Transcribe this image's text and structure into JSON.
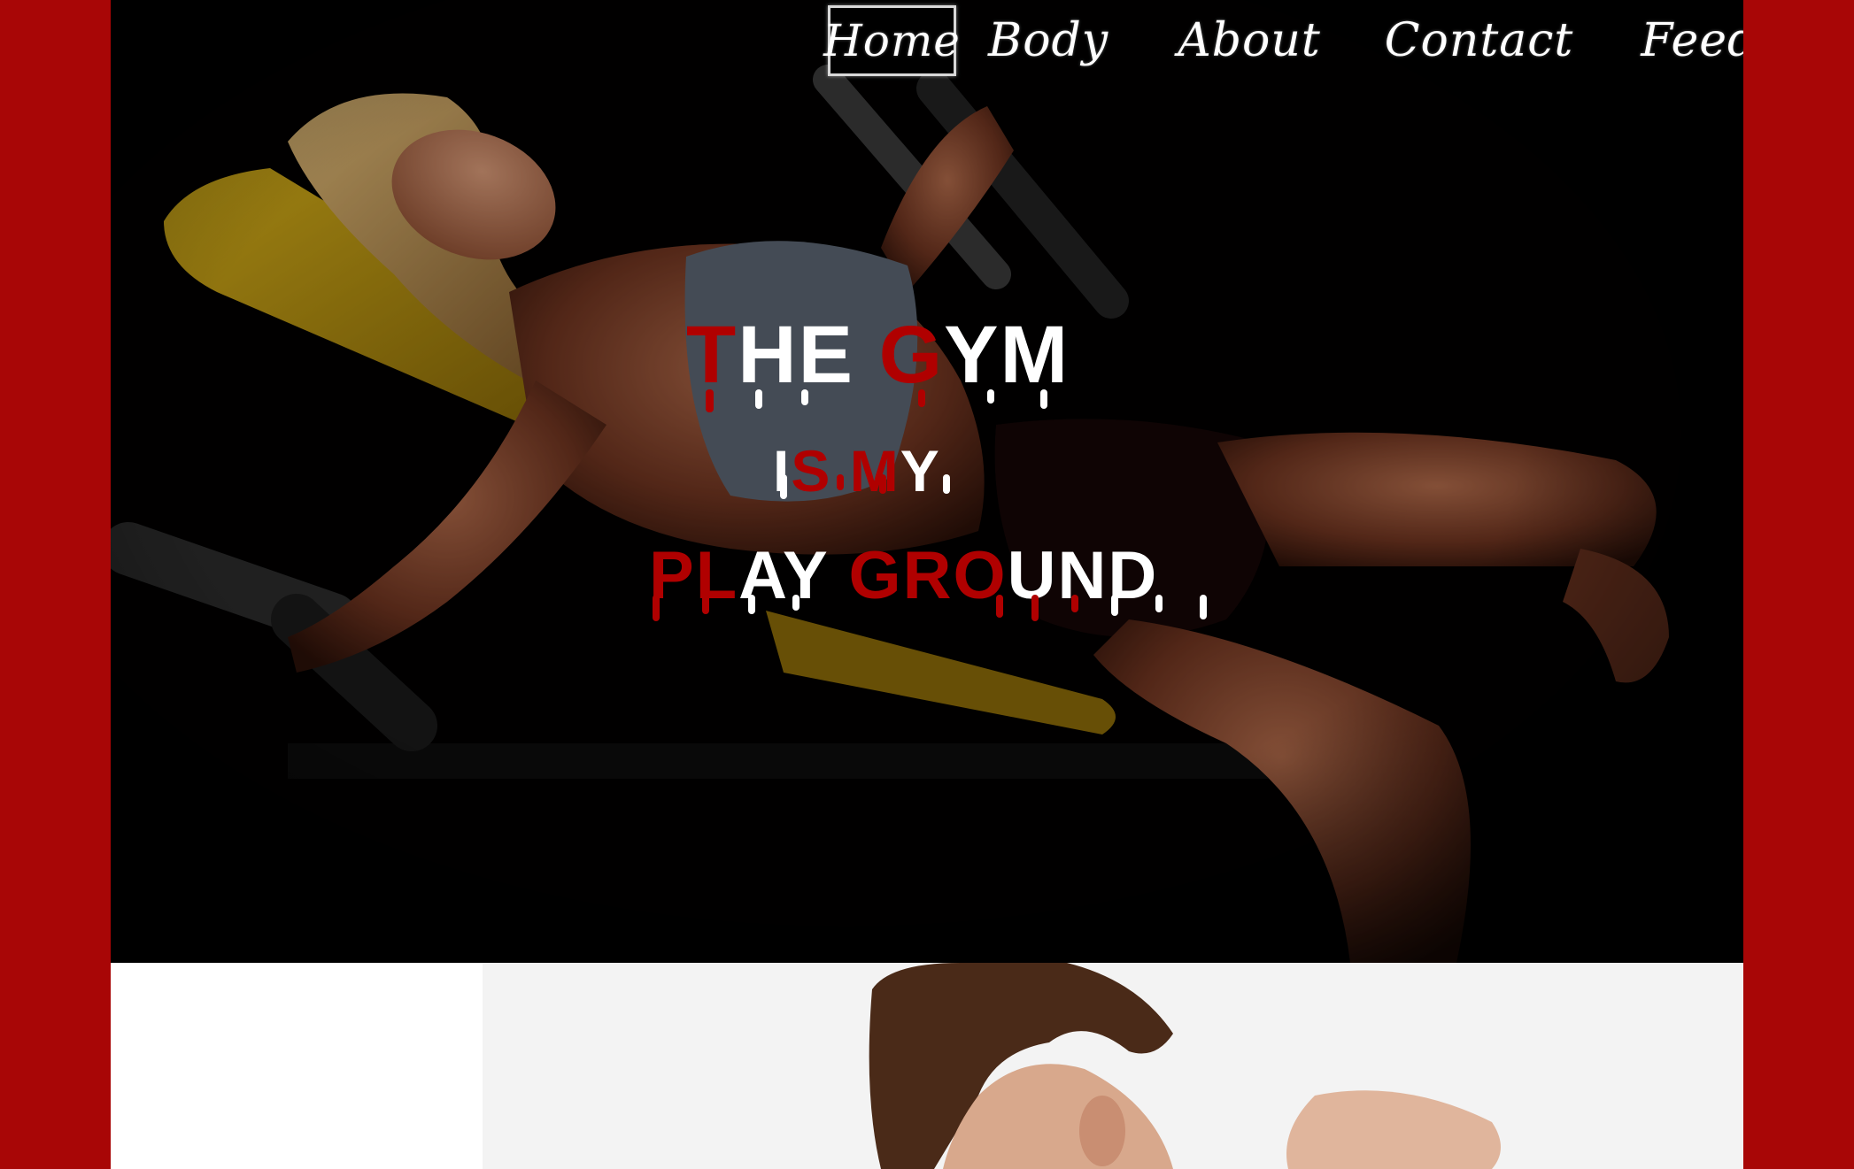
{
  "nav": {
    "items": [
      {
        "label": "Home",
        "active": true
      },
      {
        "label": "Body",
        "active": false
      },
      {
        "label": "About",
        "active": false
      },
      {
        "label": "Contact",
        "active": false
      },
      {
        "label": "Feedback",
        "active": false
      }
    ]
  },
  "hero": {
    "line1": {
      "part1_red": "T",
      "part1_white": "HE ",
      "part2_red": "G",
      "part2_white": "YM"
    },
    "line2": {
      "part1_white": "I",
      "part2_red": "S M",
      "part3_white": "Y"
    },
    "line3": {
      "part1_red": "PL",
      "part2_white": "AY ",
      "part3_red": "GRO",
      "part4_white": "UND"
    }
  },
  "colors": {
    "frame": "#a80606",
    "accent_red": "#b00000",
    "hero_bg": "#000000",
    "text": "#ffffff"
  }
}
